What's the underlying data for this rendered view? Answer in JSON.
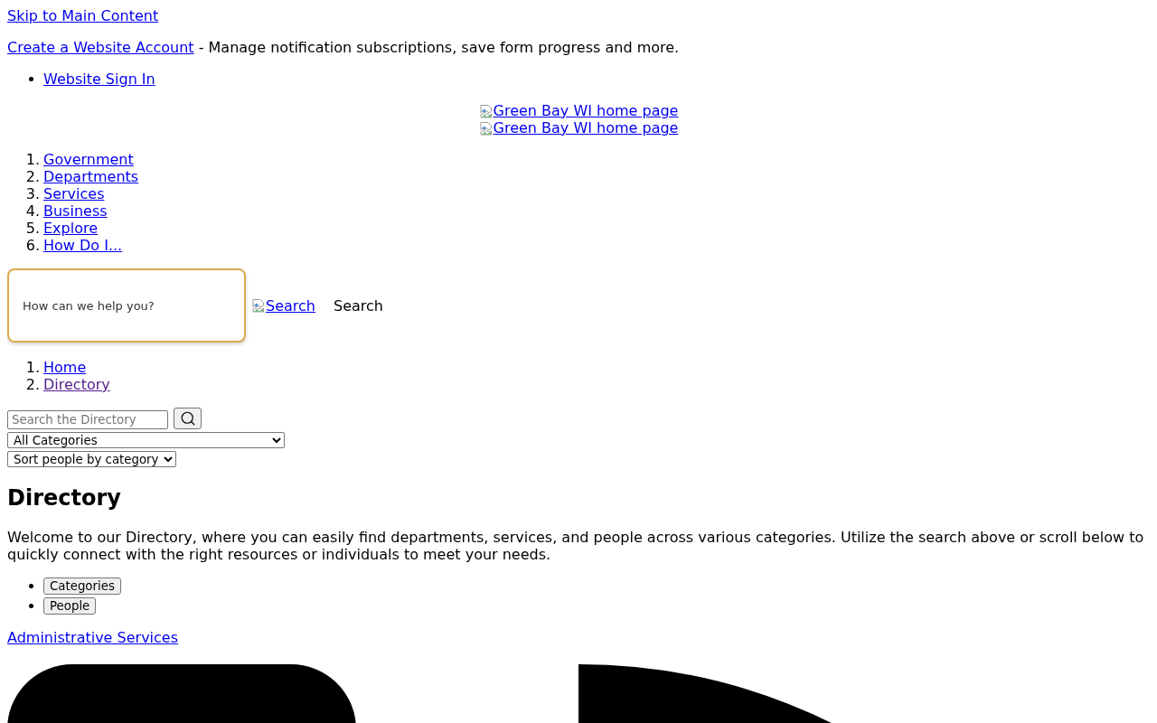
{
  "skip_link": "Skip to Main Content",
  "account_promo": {
    "link": "Create a Website Account",
    "text": " - Manage notification subscriptions, save form progress and more."
  },
  "user_menu": [
    {
      "label": "Website Sign In"
    }
  ],
  "logo_links": [
    "Green Bay WI home page",
    "Green Bay WI home page"
  ],
  "main_nav": [
    {
      "number": "1.",
      "label": "Government"
    },
    {
      "number": "2.",
      "label": "Departments"
    },
    {
      "number": "3.",
      "label": "Services"
    },
    {
      "number": "4.",
      "label": "Business"
    },
    {
      "number": "5.",
      "label": "Explore"
    },
    {
      "number": "6.",
      "label": "How Do I..."
    }
  ],
  "site_search": {
    "placeholder": "How can we help you?",
    "image_link": "Search",
    "button": "Search"
  },
  "breadcrumb": [
    {
      "number": "1.",
      "label": "Home",
      "visited": false
    },
    {
      "number": "2.",
      "label": "Directory",
      "visited": true
    }
  ],
  "directory_search": {
    "placeholder": "Search the Directory"
  },
  "category_select": {
    "value": "All Categories"
  },
  "sort_select": {
    "value": "Sort people by category"
  },
  "heading": "Directory",
  "intro": "Welcome to our Directory, where you can easily find departments, services, and people across various categories. Utilize the search above or scroll below to quickly connect with the right resources or individuals to meet your needs.",
  "view_buttons": [
    {
      "label": "Categories"
    },
    {
      "label": "People"
    }
  ],
  "category_link": "Administrative Services"
}
